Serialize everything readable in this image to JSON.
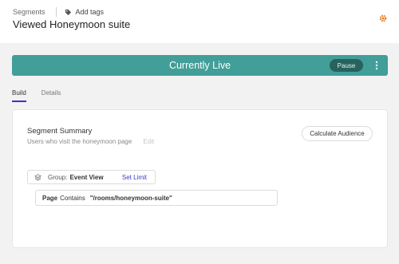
{
  "header": {
    "breadcrumb": "Segments",
    "add_tags": "Add tags",
    "title": "Viewed Honeymoon suite"
  },
  "banner": {
    "status": "Currently Live",
    "pause_label": "Pause",
    "color": "#429e98"
  },
  "tabs": [
    {
      "label": "Build",
      "active": true
    },
    {
      "label": "Details",
      "active": false
    }
  ],
  "summary": {
    "title": "Segment Summary",
    "description": "Users who visit the honeymoon page",
    "edit_label": "Edit",
    "calculate_label": "Calculate Audience"
  },
  "group": {
    "prefix": "Group:",
    "name": "Event View",
    "set_limit_label": "Set Limit"
  },
  "rule": {
    "field": "Page",
    "operator": "Contains",
    "value": "\"/rooms/honeymoon-suite\""
  },
  "colors": {
    "accent": "#3a33c4",
    "gear": "#e07a1f"
  }
}
